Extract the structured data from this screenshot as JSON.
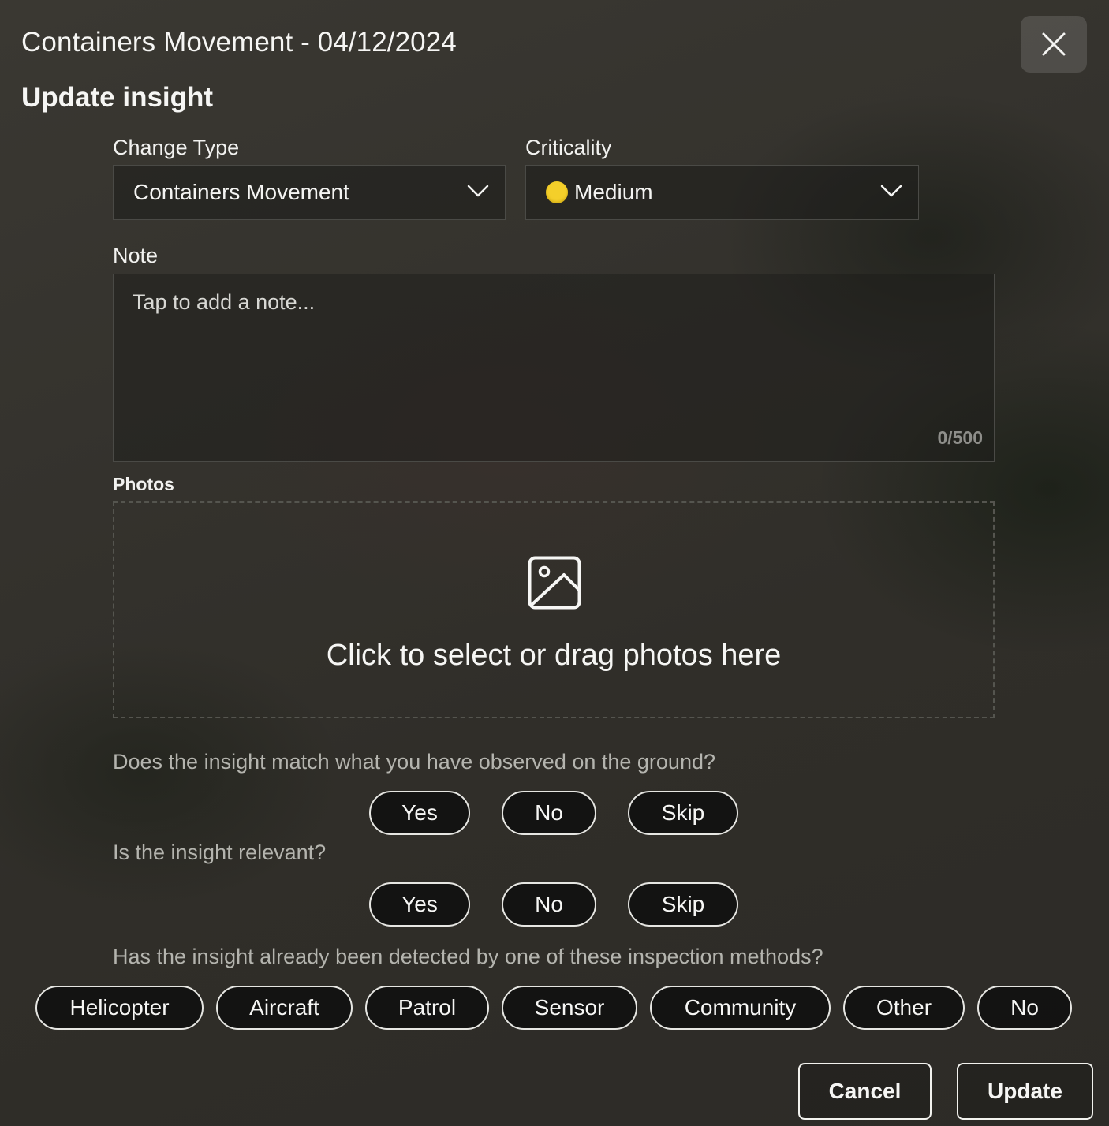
{
  "header": {
    "title": "Containers Movement - 04/12/2024",
    "close_icon": "close-icon"
  },
  "form": {
    "heading": "Update insight",
    "change_type": {
      "label": "Change Type",
      "value": "Containers Movement",
      "icon": "chevron-down-icon"
    },
    "criticality": {
      "label": "Criticality",
      "value": "Medium",
      "dot_color": "#f4cf2a",
      "icon": "chevron-down-icon"
    },
    "note": {
      "label": "Note",
      "placeholder": "Tap to add a note...",
      "counter": "0/500"
    },
    "photos": {
      "label": "Photos",
      "hint": "Click to select or drag photos here",
      "icon": "image-icon"
    }
  },
  "questions": {
    "match": {
      "text": "Does the insight match what you have observed on the ground?",
      "options": [
        "Yes",
        "No",
        "Skip"
      ]
    },
    "relevant": {
      "text": "Is the insight relevant?",
      "options": [
        "Yes",
        "No",
        "Skip"
      ]
    },
    "detected": {
      "text": "Has the insight already been detected by one of these inspection methods?",
      "options": [
        "Helicopter",
        "Aircraft",
        "Patrol",
        "Sensor",
        "Community",
        "Other",
        "No"
      ]
    }
  },
  "actions": {
    "cancel": "Cancel",
    "update": "Update"
  }
}
